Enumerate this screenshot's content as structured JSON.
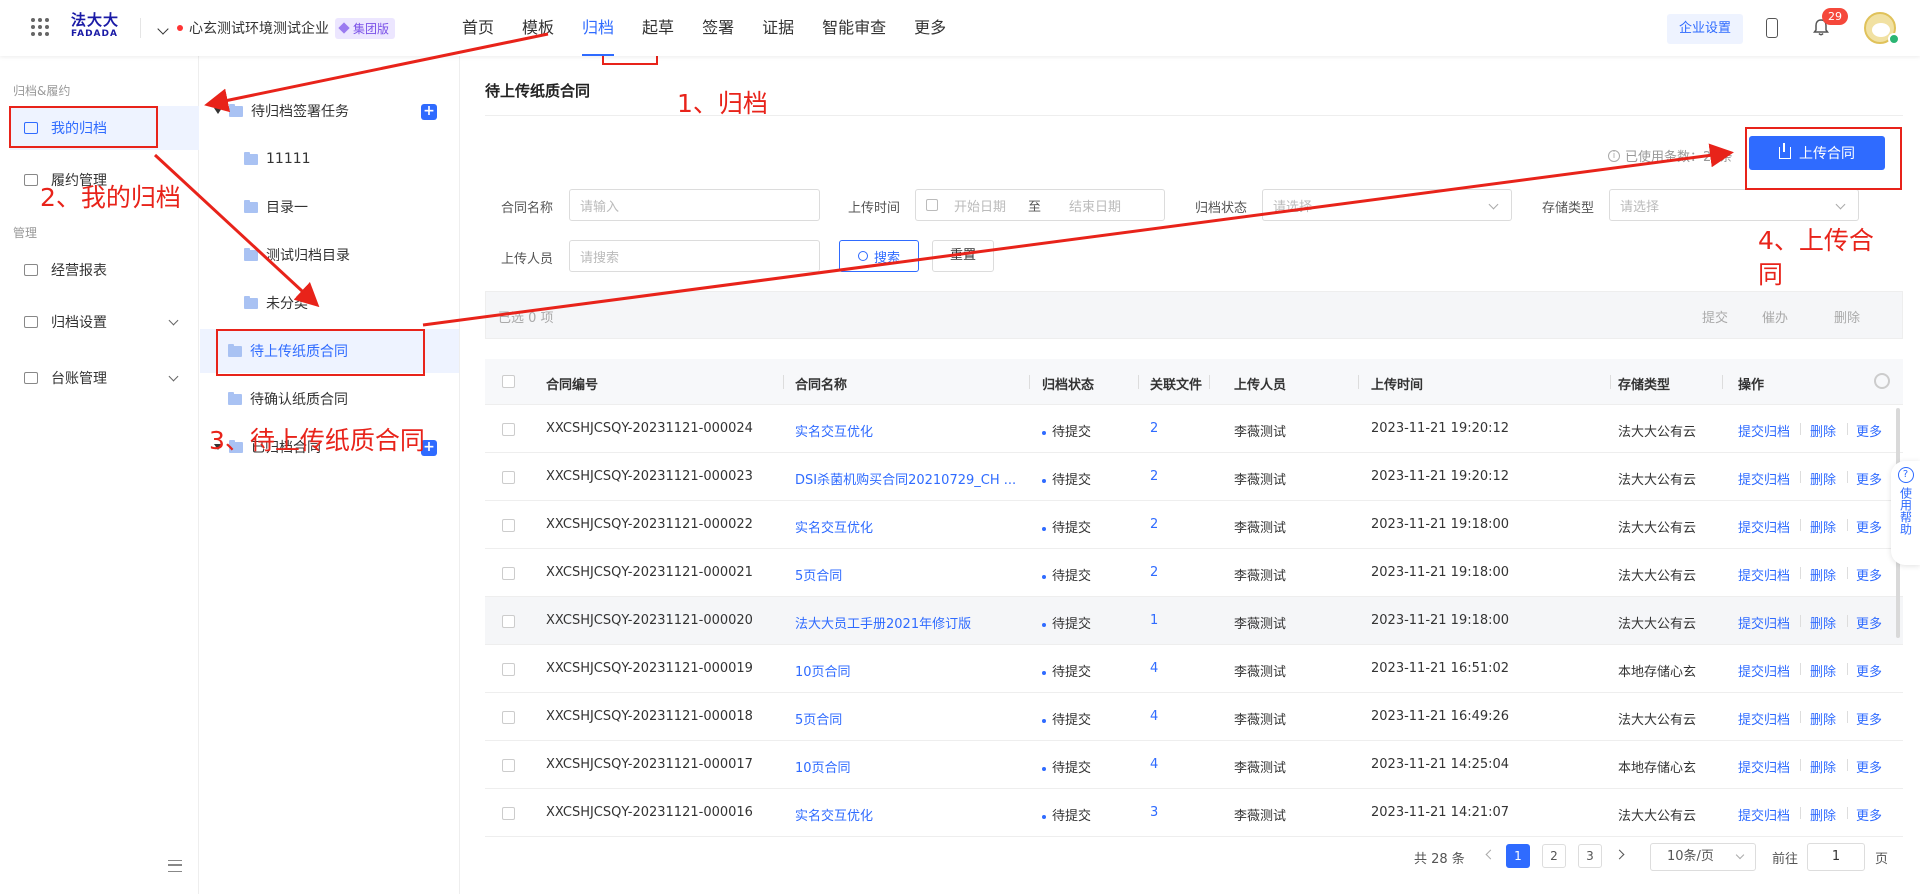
{
  "topbar": {
    "logo_line1": "法大大",
    "logo_line2": "FADADA",
    "company_name": "心玄测试环境测试企业",
    "edition_badge": "集团版",
    "nav": [
      "首页",
      "模板",
      "归档",
      "起草",
      "签署",
      "证据",
      "智能审查",
      "更多"
    ],
    "active_nav_index": 2,
    "enterprise_settings": "企业设置",
    "notification_count": "29",
    "accent_color": "#2f6bff"
  },
  "sidebar": {
    "section1": "归档&履约",
    "my_archive": "我的归档",
    "performance": "履约管理",
    "section2": "管理",
    "report": "经营报表",
    "archive_settings": "归档设置",
    "ledger": "台账管理"
  },
  "tree": {
    "pending_sign_tasks": "待归档签署任务",
    "folder_1": "11111",
    "folder_2": "目录一",
    "folder_3": "测试归档目录",
    "folder_4": "未分类",
    "pending_upload": "待上传纸质合同",
    "pending_confirm": "待确认纸质合同",
    "archived": "已归档合同"
  },
  "main": {
    "title": "待上传纸质合同",
    "used_count": "已使用条数：28条",
    "upload_button": "上传合同"
  },
  "filters": {
    "contract_name_label": "合同名称",
    "contract_name_placeholder": "请输入",
    "upload_time_label": "上传时间",
    "start_date": "开始日期",
    "to": "至",
    "end_date": "结束日期",
    "archive_status_label": "归档状态",
    "archive_status_placeholder": "请选择",
    "storage_type_label": "存储类型",
    "storage_type_placeholder": "请选择",
    "uploader_label": "上传人员",
    "uploader_placeholder": "请搜索",
    "search_button": "搜索",
    "reset_button": "重置"
  },
  "batch": {
    "selected": "已选 0 项",
    "submit": "提交",
    "remind": "催办",
    "delete": "删除"
  },
  "table": {
    "headers": [
      "合同编号",
      "合同名称",
      "归档状态",
      "关联文件",
      "上传人员",
      "上传时间",
      "存储类型",
      "操作"
    ],
    "rows": [
      {
        "no": "XXCSHJCSQY-20231121-000024",
        "name": "实名交互优化",
        "status": "待提交",
        "files": "2",
        "uploader": "李薇测试",
        "time": "2023-11-21 19:20:12",
        "storage": "法大大公有云"
      },
      {
        "no": "XXCSHJCSQY-20231121-000023",
        "name": "DSI杀菌机购买合同20210729_CH ...",
        "status": "待提交",
        "files": "2",
        "uploader": "李薇测试",
        "time": "2023-11-21 19:20:12",
        "storage": "法大大公有云"
      },
      {
        "no": "XXCSHJCSQY-20231121-000022",
        "name": "实名交互优化",
        "status": "待提交",
        "files": "2",
        "uploader": "李薇测试",
        "time": "2023-11-21 19:18:00",
        "storage": "法大大公有云"
      },
      {
        "no": "XXCSHJCSQY-20231121-000021",
        "name": "5页合同",
        "status": "待提交",
        "files": "2",
        "uploader": "李薇测试",
        "time": "2023-11-21 19:18:00",
        "storage": "法大大公有云"
      },
      {
        "no": "XXCSHJCSQY-20231121-000020",
        "name": "法大大员工手册2021年修订版",
        "status": "待提交",
        "files": "1",
        "uploader": "李薇测试",
        "time": "2023-11-21 19:18:00",
        "storage": "法大大公有云"
      },
      {
        "no": "XXCSHJCSQY-20231121-000019",
        "name": "10页合同",
        "status": "待提交",
        "files": "4",
        "uploader": "李薇测试",
        "time": "2023-11-21 16:51:02",
        "storage": "本地存储心玄"
      },
      {
        "no": "XXCSHJCSQY-20231121-000018",
        "name": "5页合同",
        "status": "待提交",
        "files": "4",
        "uploader": "李薇测试",
        "time": "2023-11-21 16:49:26",
        "storage": "法大大公有云"
      },
      {
        "no": "XXCSHJCSQY-20231121-000017",
        "name": "10页合同",
        "status": "待提交",
        "files": "4",
        "uploader": "李薇测试",
        "time": "2023-11-21 14:25:04",
        "storage": "本地存储心玄"
      },
      {
        "no": "XXCSHJCSQY-20231121-000016",
        "name": "实名交互优化",
        "status": "待提交",
        "files": "3",
        "uploader": "李薇测试",
        "time": "2023-11-21 14:21:07",
        "storage": "法大大公有云"
      }
    ],
    "op_submit": "提交归档",
    "op_delete": "删除",
    "op_more": "更多"
  },
  "pager": {
    "total": "共 28 条",
    "pages": [
      "1",
      "2",
      "3"
    ],
    "page_size": "10条/页",
    "goto_label": "前往",
    "goto_value": "1",
    "page_unit": "页"
  },
  "help": {
    "text": "使用帮助"
  },
  "annotations": {
    "step1": "1、归档",
    "step2": "2、我的归档",
    "step3": "3、待上传纸质合同",
    "step4a": "4、上传合",
    "step4b": "同",
    "color": "#e8231a"
  }
}
